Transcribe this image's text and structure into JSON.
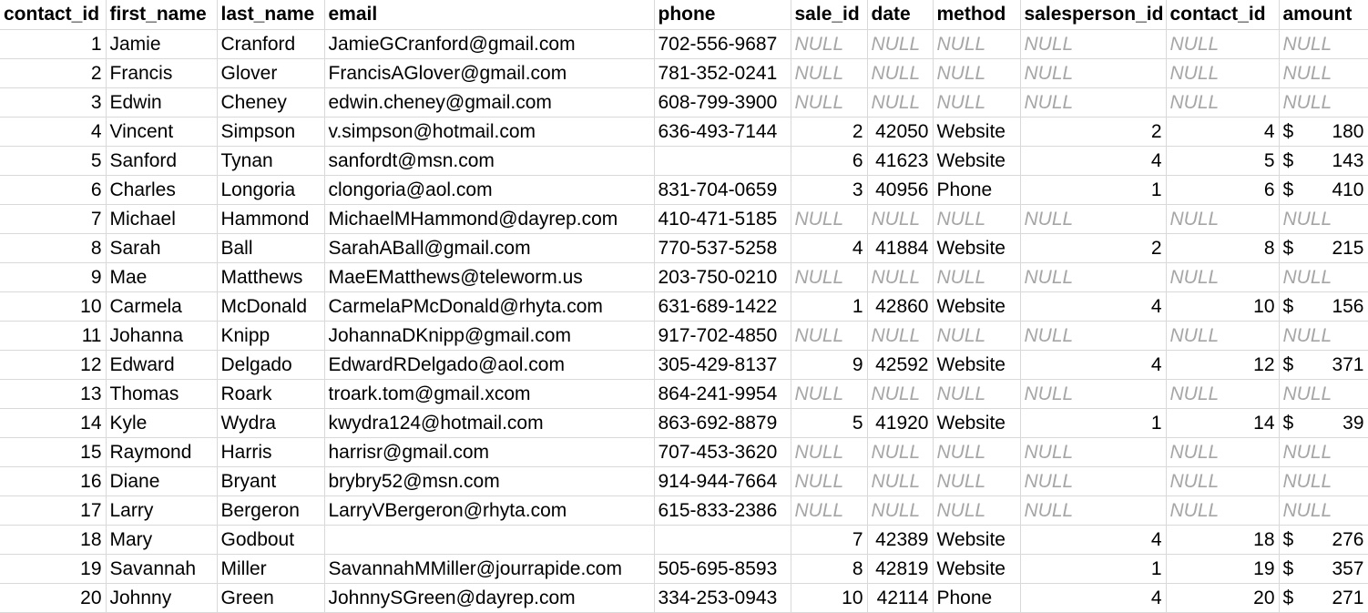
{
  "columns": [
    "contact_id",
    "first_name",
    "last_name",
    "email",
    "phone",
    "sale_id",
    "date",
    "method",
    "salesperson_id",
    "contact_id",
    "amount"
  ],
  "currency_symbol": "$",
  "null_text": "NULL",
  "rows": [
    [
      "1",
      "Jamie",
      "Cranford",
      "JamieGCranford@gmail.com",
      "702-556-9687",
      null,
      null,
      null,
      null,
      null,
      null
    ],
    [
      "2",
      "Francis",
      "Glover",
      "FrancisAGlover@gmail.com",
      "781-352-0241",
      null,
      null,
      null,
      null,
      null,
      null
    ],
    [
      "3",
      "Edwin",
      "Cheney",
      "edwin.cheney@gmail.com",
      "608-799-3900",
      null,
      null,
      null,
      null,
      null,
      null
    ],
    [
      "4",
      "Vincent",
      "Simpson",
      "v.simpson@hotmail.com",
      "636-493-7144",
      "2",
      "42050",
      "Website",
      "2",
      "4",
      "180"
    ],
    [
      "5",
      "Sanford",
      "Tynan",
      "sanfordt@msn.com",
      "",
      "6",
      "41623",
      "Website",
      "4",
      "5",
      "143"
    ],
    [
      "6",
      "Charles",
      "Longoria",
      "clongoria@aol.com",
      "831-704-0659",
      "3",
      "40956",
      "Phone",
      "1",
      "6",
      "410"
    ],
    [
      "7",
      "Michael",
      "Hammond",
      "MichaelMHammond@dayrep.com",
      "410-471-5185",
      null,
      null,
      null,
      null,
      null,
      null
    ],
    [
      "8",
      "Sarah",
      "Ball",
      "SarahABall@gmail.com",
      "770-537-5258",
      "4",
      "41884",
      "Website",
      "2",
      "8",
      "215"
    ],
    [
      "9",
      "Mae",
      "Matthews",
      "MaeEMatthews@teleworm.us",
      "203-750-0210",
      null,
      null,
      null,
      null,
      null,
      null
    ],
    [
      "10",
      "Carmela",
      "McDonald",
      "CarmelaPMcDonald@rhyta.com",
      "631-689-1422",
      "1",
      "42860",
      "Website",
      "4",
      "10",
      "156"
    ],
    [
      "11",
      "Johanna",
      "Knipp",
      "JohannaDKnipp@gmail.com",
      "917-702-4850",
      null,
      null,
      null,
      null,
      null,
      null
    ],
    [
      "12",
      "Edward",
      "Delgado",
      "EdwardRDelgado@aol.com",
      "305-429-8137",
      "9",
      "42592",
      "Website",
      "4",
      "12",
      "371"
    ],
    [
      "13",
      "Thomas",
      "Roark",
      "troark.tom@gmail.xcom",
      "864-241-9954",
      null,
      null,
      null,
      null,
      null,
      null
    ],
    [
      "14",
      "Kyle",
      "Wydra",
      "kwydra124@hotmail.com",
      "863-692-8879",
      "5",
      "41920",
      "Website",
      "1",
      "14",
      "39"
    ],
    [
      "15",
      "Raymond",
      "Harris",
      "harrisr@gmail.com",
      "707-453-3620",
      null,
      null,
      null,
      null,
      null,
      null
    ],
    [
      "16",
      "Diane",
      "Bryant",
      "brybry52@msn.com",
      "914-944-7664",
      null,
      null,
      null,
      null,
      null,
      null
    ],
    [
      "17",
      "Larry",
      "Bergeron",
      "LarryVBergeron@rhyta.com",
      "615-833-2386",
      null,
      null,
      null,
      null,
      null,
      null
    ],
    [
      "18",
      "Mary",
      "Godbout",
      "",
      "",
      "7",
      "42389",
      "Website",
      "4",
      "18",
      "276"
    ],
    [
      "19",
      "Savannah",
      "Miller",
      "SavannahMMiller@jourrapide.com",
      "505-695-8593",
      "8",
      "42819",
      "Website",
      "1",
      "19",
      "357"
    ],
    [
      "20",
      "Johnny",
      "Green",
      "JohnnySGreen@dayrep.com",
      "334-253-0943",
      "10",
      "42114",
      "Phone",
      "4",
      "20",
      "271"
    ]
  ]
}
